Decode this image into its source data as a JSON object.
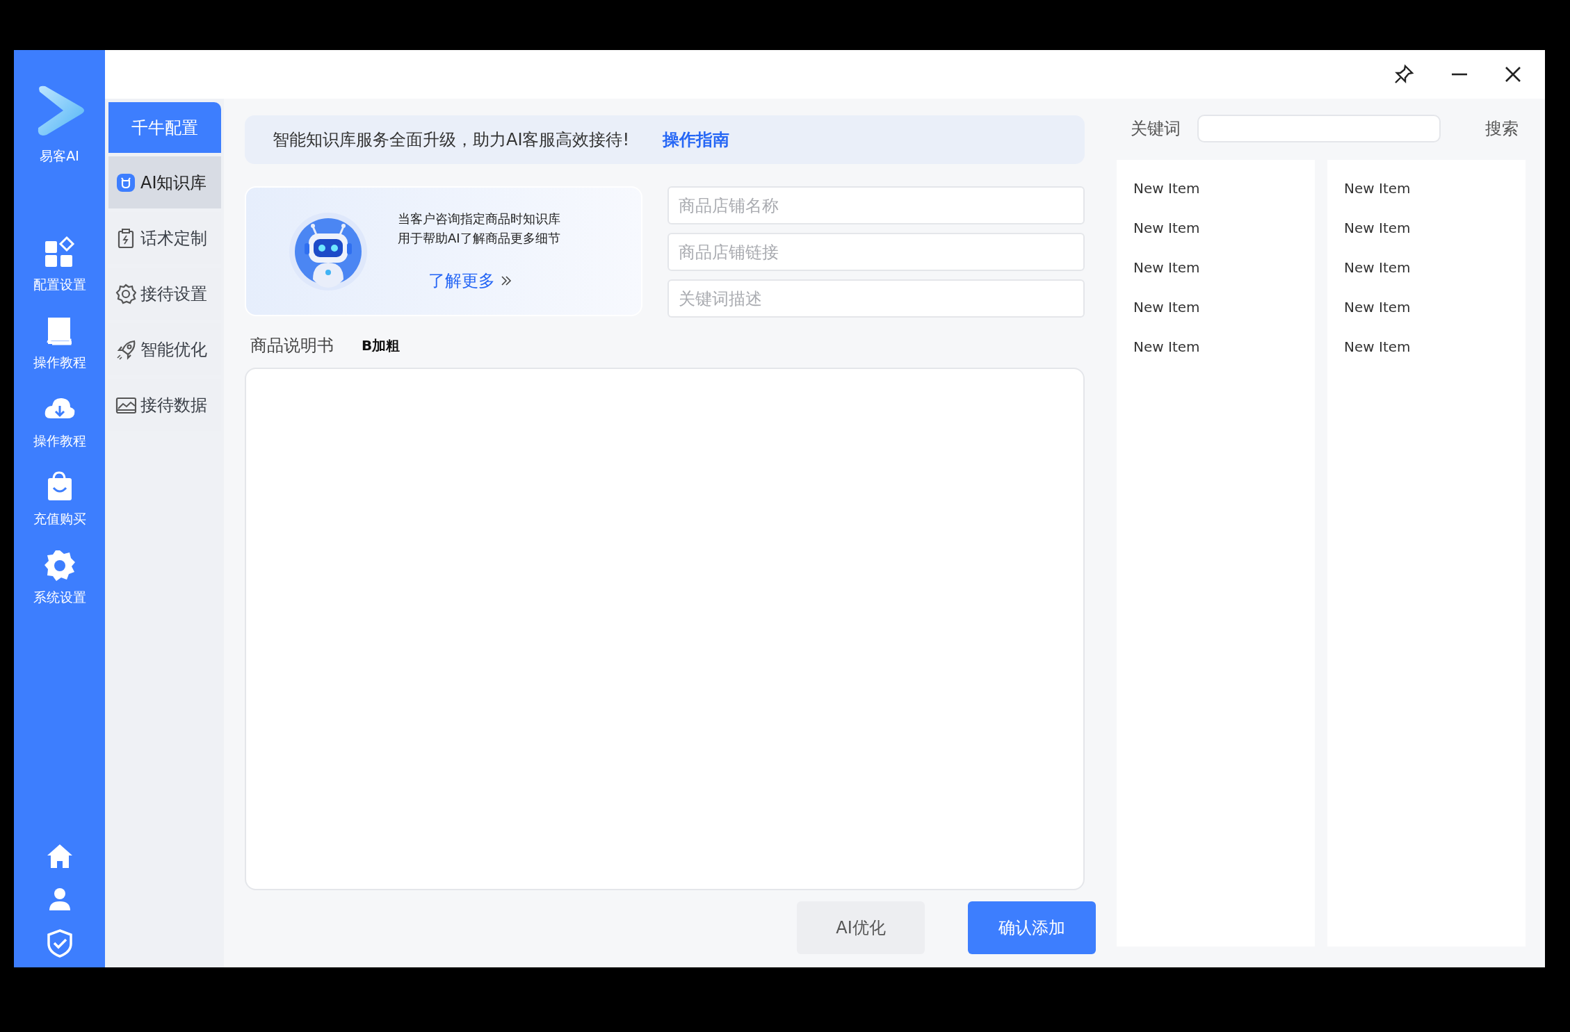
{
  "app": {
    "name": "易客AI"
  },
  "rail": {
    "items": [
      {
        "label": "配置设置"
      },
      {
        "label": "操作教程"
      },
      {
        "label": "操作教程"
      },
      {
        "label": "充值购买"
      },
      {
        "label": "系统设置"
      }
    ]
  },
  "menu": {
    "header": "千牛配置",
    "items": [
      {
        "label": "AI知识库",
        "selected": true
      },
      {
        "label": "话术定制",
        "selected": false
      },
      {
        "label": "接待设置",
        "selected": false
      },
      {
        "label": "智能优化",
        "selected": false
      },
      {
        "label": "接待数据",
        "selected": false
      }
    ]
  },
  "banner": {
    "text": "智能知识库服务全面升级，助力AI客服高效接待!",
    "link": "操作指南"
  },
  "info_card": {
    "text": "当客户咨询指定商品时知识库用于帮助AI了解商品更多细节",
    "link": "了解更多"
  },
  "fields": [
    {
      "placeholder": "商品店铺名称"
    },
    {
      "placeholder": "商品店铺链接"
    },
    {
      "placeholder": "关键词描述"
    }
  ],
  "editor": {
    "label": "商品说明书",
    "bold_button": "B加粗"
  },
  "buttons": [
    {
      "label": "AI优化",
      "kind": "secondary"
    },
    {
      "label": "确认添加",
      "kind": "primary"
    }
  ],
  "search": {
    "label": "关键词",
    "button": "搜索"
  },
  "lists": [
    {
      "items": [
        "New Item",
        "New Item",
        "New Item",
        "New Item",
        "New Item"
      ]
    },
    {
      "items": [
        "New Item",
        "New Item",
        "New Item",
        "New Item",
        "New Item"
      ]
    }
  ]
}
